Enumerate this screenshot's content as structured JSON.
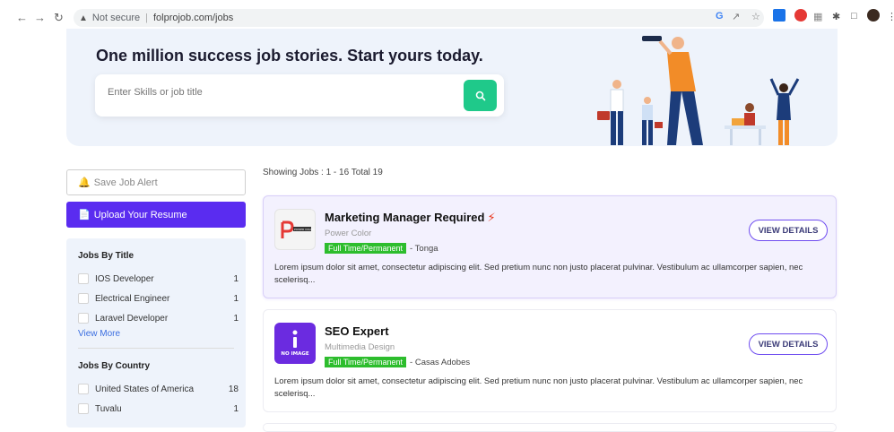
{
  "browser": {
    "security_label": "Not secure",
    "url": "folprojob.com/jobs"
  },
  "hero": {
    "title": "One million success job stories. Start yours today.",
    "search_placeholder": "Enter Skills or job title"
  },
  "sidebar": {
    "save_alert_label": "Save Job Alert",
    "upload_resume_label": "Upload Your Resume",
    "jobs_by_title": {
      "heading": "Jobs By Title",
      "items": [
        {
          "label": "IOS Developer",
          "count": "1"
        },
        {
          "label": "Electrical Engineer",
          "count": "1"
        },
        {
          "label": "Laravel Developer",
          "count": "1"
        }
      ],
      "view_more": "View More"
    },
    "jobs_by_country": {
      "heading": "Jobs By Country",
      "items": [
        {
          "label": "United States of America",
          "count": "18"
        },
        {
          "label": "Tuvalu",
          "count": "1"
        }
      ]
    }
  },
  "results": {
    "summary": "Showing Jobs : 1 - 16 Total 19",
    "jobs": [
      {
        "title": "Marketing Manager Required",
        "featured": true,
        "company": "Power Color",
        "employment_type": "Full Time/Permanent",
        "location": "- Tonga",
        "description": "Lorem ipsum dolor sit amet, consectetur adipiscing elit. Sed pretium nunc non justo placerat pulvinar. Vestibulum ac ullamcorper sapien, nec scelerisq...",
        "button_label": "VIEW DETAILS",
        "logo_text": "POWER COLOR"
      },
      {
        "title": "SEO Expert",
        "featured": false,
        "company": "Multimedia Design",
        "employment_type": "Full Time/Permanent",
        "location": "- Casas Adobes",
        "description": "Lorem ipsum dolor sit amet, consectetur adipiscing elit. Sed pretium nunc non justo placerat pulvinar. Vestibulum ac ullamcorper sapien, nec scelerisq...",
        "button_label": "VIEW DETAILS",
        "logo_text": "NO IMAGE"
      }
    ]
  },
  "colors": {
    "accent": "#5a2cf0",
    "search_button": "#1fc98a",
    "badge": "#2dbd2d",
    "hero_bg": "#eef3fb"
  }
}
